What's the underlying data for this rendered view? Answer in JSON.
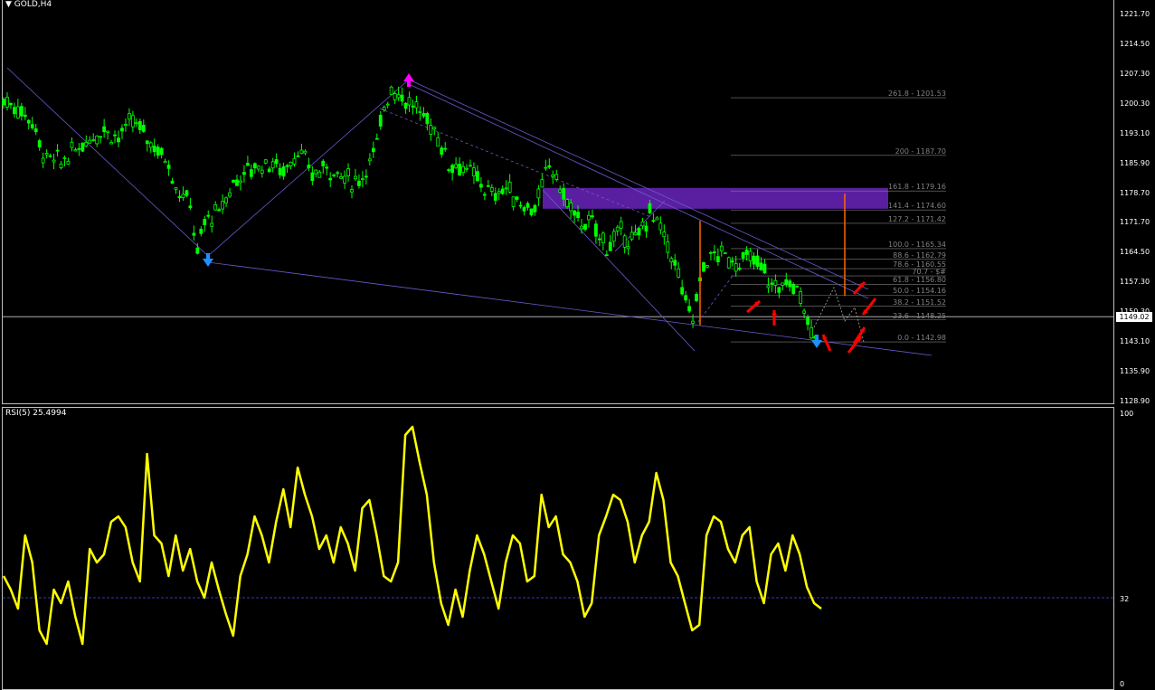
{
  "header": {
    "title": "GOLD,H4",
    "menu_icon": "triangle-down-icon"
  },
  "rsi": {
    "label": "RSI(5) 25.4994",
    "levels": [
      "100",
      "32",
      "0"
    ],
    "level_value": 32
  },
  "price_axis": {
    "ticks": [
      "1221.70",
      "1214.50",
      "1207.30",
      "1200.30",
      "1193.10",
      "1185.90",
      "1178.70",
      "1171.70",
      "1164.50",
      "1157.30",
      "1150.30",
      "1143.10",
      "1135.90",
      "1128.90"
    ],
    "current": "1149.02"
  },
  "fib_levels": [
    {
      "label": "261.8 - 1201.53",
      "price": 1201.53
    },
    {
      "label": "200 - 1187.70",
      "price": 1187.7
    },
    {
      "label": "161.8 - 1179.16",
      "price": 1179.16
    },
    {
      "label": "141.4 - 1174.60",
      "price": 1174.6
    },
    {
      "label": "127.2 - 1171.42",
      "price": 1171.42
    },
    {
      "label": "100.0 - 1165.34",
      "price": 1165.34
    },
    {
      "label": "88.6 - 1162.79",
      "price": 1162.79
    },
    {
      "label": "78.6 - 1160.55",
      "price": 1160.55
    },
    {
      "label": "70.7 - $#",
      "price": 1158.8
    },
    {
      "label": "61.8 - 1156.80",
      "price": 1156.8
    },
    {
      "label": "50.0 - 1154.16",
      "price": 1154.16
    },
    {
      "label": "38.2 - 1151.52",
      "price": 1151.52
    },
    {
      "label": "23.6 - 1148.25",
      "price": 1148.25
    },
    {
      "label": "0.0 - 1142.98",
      "price": 1142.98
    }
  ],
  "colors": {
    "up_candle": "#00ff00",
    "down_candle": "#00ff00",
    "rsi_line": "#ffff00",
    "trend_lines": "#6a5acd",
    "zone": "#5a1fa0",
    "arrows": "#ff0000",
    "fib": "#808080"
  },
  "chart_data": {
    "type": "line",
    "price_range": [
      1128.9,
      1221.7
    ],
    "rsi_range": [
      0,
      100
    ],
    "price_path": [
      [
        0,
        1201
      ],
      [
        4,
        1199
      ],
      [
        8,
        1196
      ],
      [
        10,
        1190
      ],
      [
        12,
        1187
      ],
      [
        16,
        1186
      ],
      [
        20,
        1189
      ],
      [
        24,
        1192
      ],
      [
        28,
        1194
      ],
      [
        32,
        1192
      ],
      [
        36,
        1196
      ],
      [
        40,
        1192
      ],
      [
        44,
        1188
      ],
      [
        46,
        1186
      ],
      [
        48,
        1180
      ],
      [
        52,
        1176
      ],
      [
        54,
        1164
      ],
      [
        56,
        1172
      ],
      [
        60,
        1174
      ],
      [
        64,
        1181
      ],
      [
        66,
        1183
      ],
      [
        70,
        1185
      ],
      [
        74,
        1186
      ],
      [
        78,
        1184
      ],
      [
        82,
        1189
      ],
      [
        86,
        1183
      ],
      [
        90,
        1185
      ],
      [
        94,
        1183
      ],
      [
        98,
        1181
      ],
      [
        100,
        1183
      ],
      [
        104,
        1190
      ],
      [
        106,
        1200
      ],
      [
        108,
        1204
      ],
      [
        112,
        1201
      ],
      [
        116,
        1198
      ],
      [
        120,
        1194
      ],
      [
        124,
        1186
      ],
      [
        128,
        1185
      ],
      [
        132,
        1182
      ],
      [
        136,
        1178
      ],
      [
        140,
        1180
      ],
      [
        144,
        1176
      ],
      [
        148,
        1175
      ],
      [
        150,
        1180
      ],
      [
        152,
        1186
      ],
      [
        156,
        1178
      ],
      [
        160,
        1172
      ],
      [
        164,
        1171
      ],
      [
        168,
        1166
      ],
      [
        172,
        1169
      ],
      [
        176,
        1167
      ],
      [
        180,
        1174
      ],
      [
        182,
        1172
      ],
      [
        184,
        1168
      ],
      [
        186,
        1164
      ],
      [
        188,
        1159
      ],
      [
        190,
        1152
      ],
      [
        192,
        1149
      ],
      [
        194,
        1158
      ],
      [
        196,
        1163
      ],
      [
        200,
        1164
      ],
      [
        204,
        1162
      ],
      [
        208,
        1163
      ],
      [
        212,
        1160
      ],
      [
        214,
        1156
      ],
      [
        218,
        1157
      ],
      [
        222,
        1155
      ],
      [
        224,
        1148
      ],
      [
        226,
        1145
      ],
      [
        227,
        1150
      ]
    ],
    "rsi_values": [
      40,
      35,
      28,
      55,
      45,
      20,
      15,
      35,
      30,
      38,
      25,
      15,
      50,
      45,
      48,
      60,
      62,
      58,
      45,
      38,
      85,
      55,
      52,
      40,
      55,
      42,
      50,
      38,
      32,
      45,
      35,
      26,
      18,
      40,
      48,
      62,
      55,
      45,
      60,
      72,
      58,
      80,
      70,
      62,
      50,
      55,
      45,
      58,
      52,
      42,
      65,
      68,
      55,
      40,
      38,
      45,
      92,
      95,
      82,
      70,
      45,
      30,
      22,
      35,
      25,
      42,
      55,
      48,
      38,
      28,
      45,
      55,
      52,
      38,
      40,
      70,
      58,
      62,
      48,
      45,
      38,
      25,
      30,
      55,
      62,
      70,
      68,
      60,
      45,
      55,
      60,
      78,
      68,
      45,
      40,
      30,
      20,
      22,
      55,
      62,
      60,
      50,
      45,
      55,
      58,
      38,
      30,
      48,
      52,
      42,
      55,
      48,
      36,
      30,
      28
    ]
  }
}
